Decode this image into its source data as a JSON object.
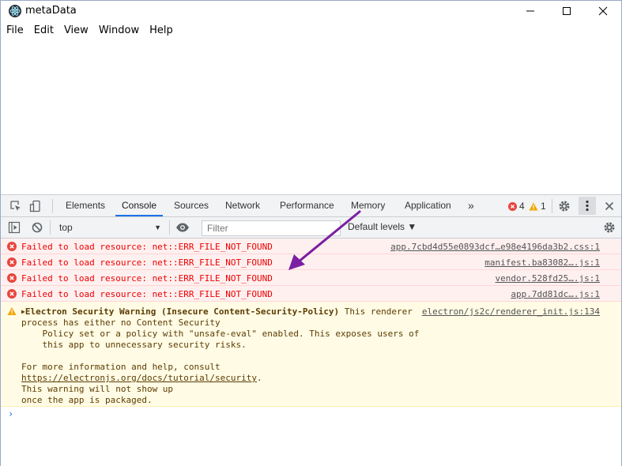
{
  "window": {
    "title": "metaData"
  },
  "menu": [
    "File",
    "Edit",
    "View",
    "Window",
    "Help"
  ],
  "devtools": {
    "tabs": [
      "Elements",
      "Console",
      "Sources",
      "Network",
      "Performance",
      "Memory",
      "Application"
    ],
    "active_tab": "Console",
    "more_tabs": "»",
    "error_count": "4",
    "warning_count": "1",
    "context": "top",
    "filter_placeholder": "Filter",
    "levels": "Default levels ▼"
  },
  "errors": [
    {
      "message": "Failed to load resource: net::ERR_FILE_NOT_FOUND",
      "source": "app.7cbd4d55e0893dcf…e98e4196da3b2.css:1"
    },
    {
      "message": "Failed to load resource: net::ERR_FILE_NOT_FOUND",
      "source": "manifest.ba83082….js:1"
    },
    {
      "message": "Failed to load resource: net::ERR_FILE_NOT_FOUND",
      "source": "vendor.528fd25….js:1"
    },
    {
      "message": "Failed to load resource: net::ERR_FILE_NOT_FOUND",
      "source": "app.7dd81dc….js:1"
    }
  ],
  "warning": {
    "heading": "Electron Security Warning (Insecure Content-Security-Policy)",
    "heading_tail": " This renderer",
    "source": "electron/js2c/renderer_init.js:134",
    "line2": "process has either no Content Security",
    "line3": "    Policy set or a policy with \"unsafe-eval\" enabled. This exposes users of",
    "line4": "    this app to unnecessary security risks.",
    "line5": "For more information and help, consult",
    "link": "https://electronjs.org/docs/tutorial/security",
    "link_tail": ".",
    "line7": "This warning will not show up",
    "line8": "once the app is packaged."
  },
  "prompt": "›",
  "colors": {
    "accent": "#1a73e8",
    "error": "#e00000",
    "annotation_arrow": "#7b1fa2"
  }
}
